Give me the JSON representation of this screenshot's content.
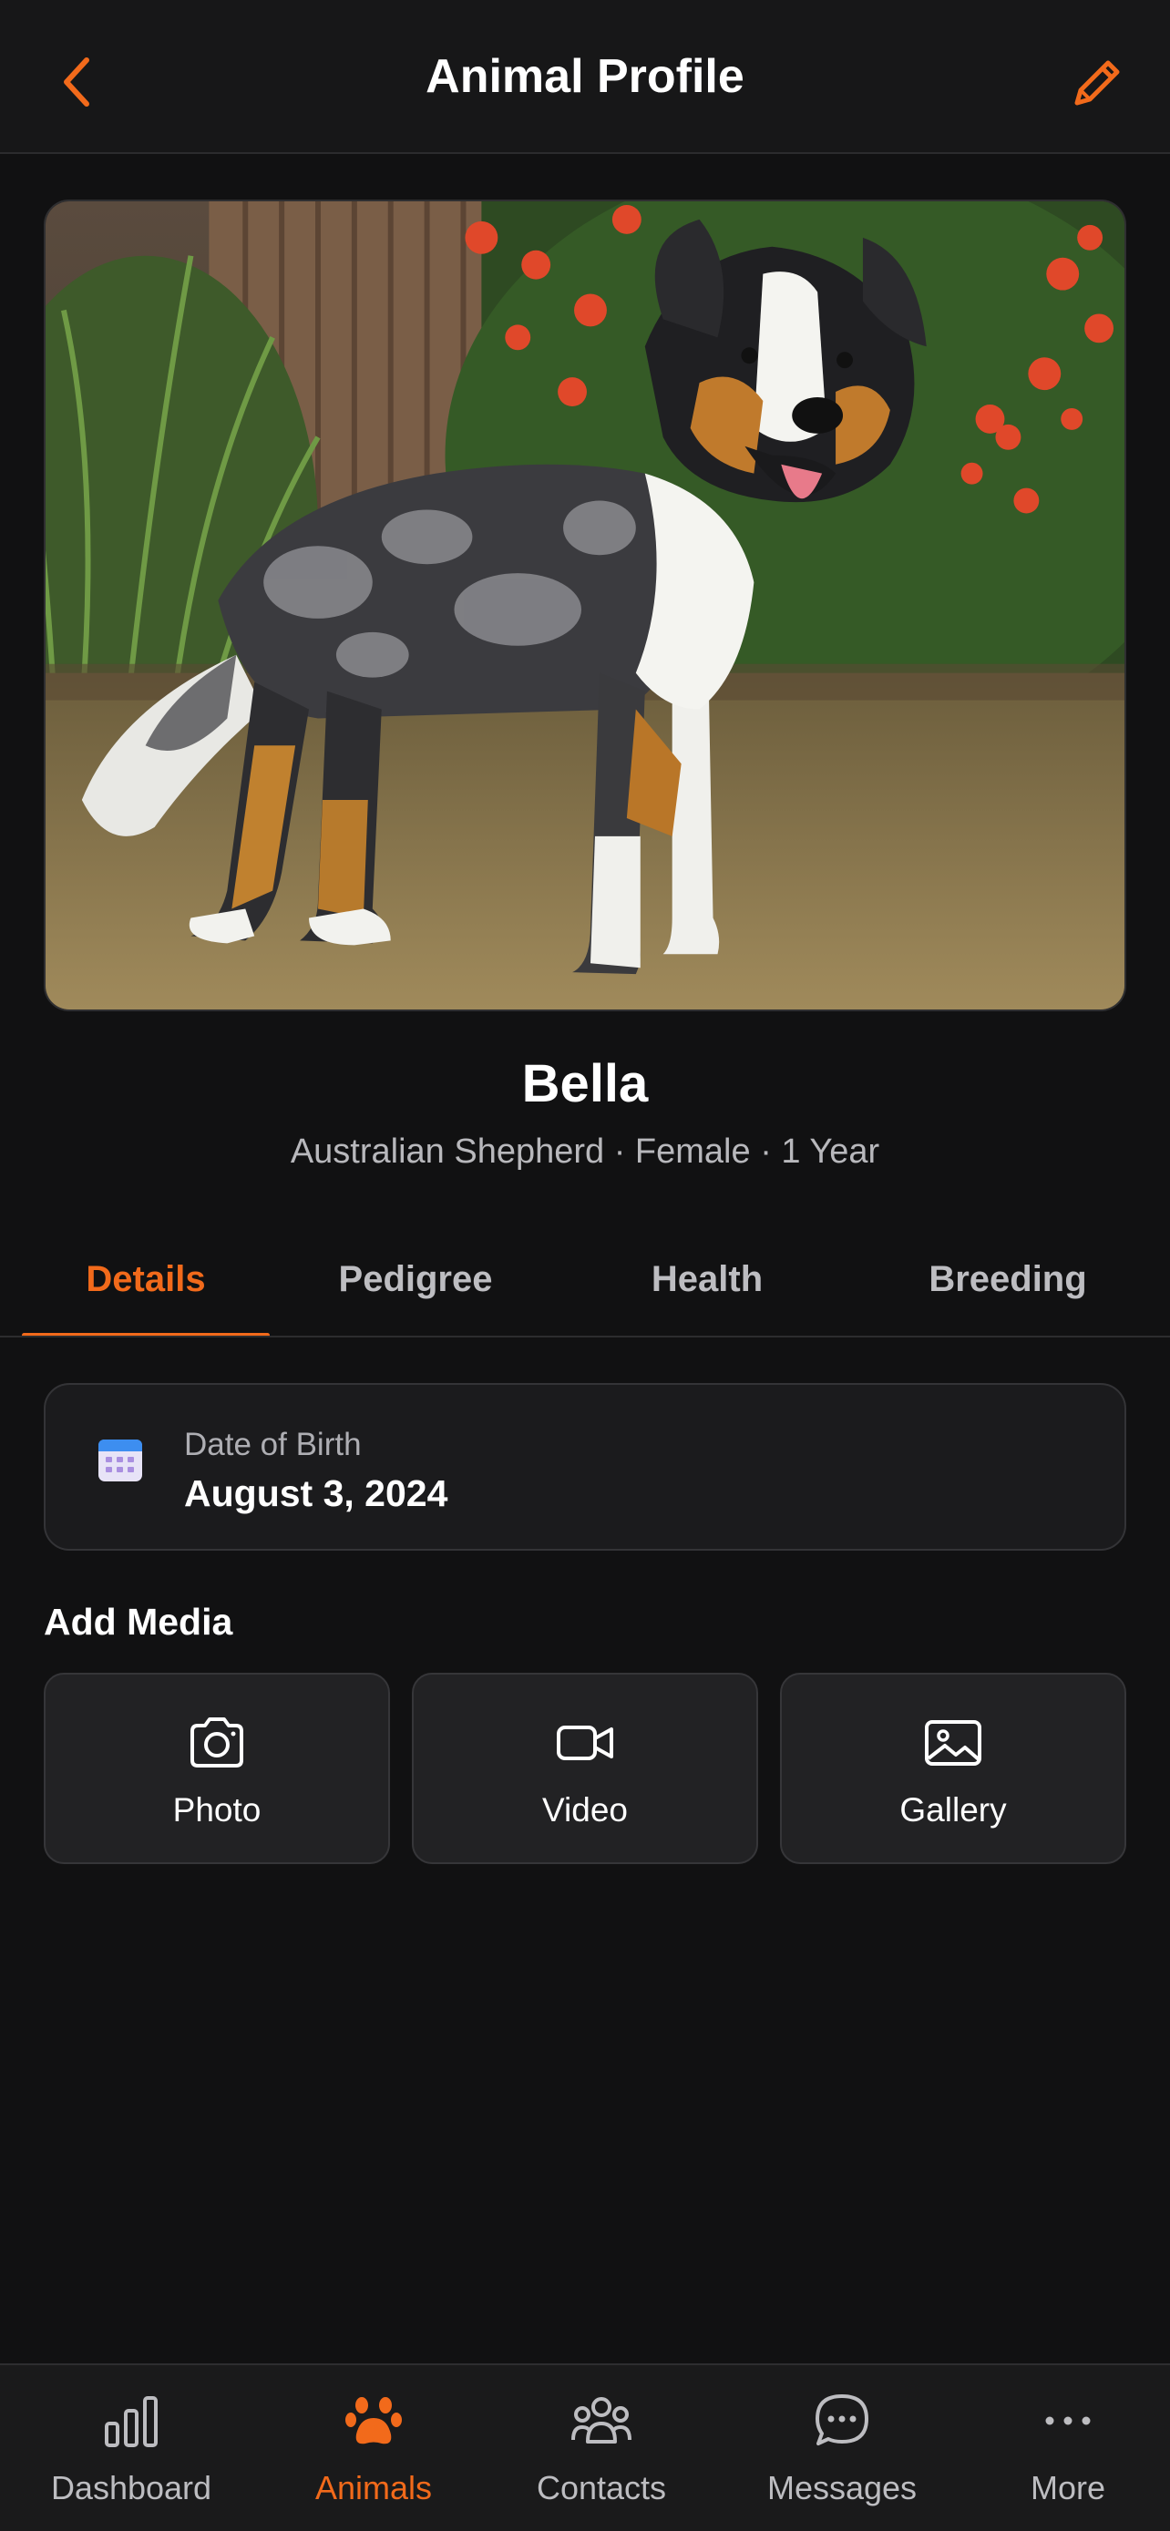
{
  "header": {
    "title": "Animal Profile",
    "back_icon": "chevron-left-icon",
    "edit_icon": "pencil-icon",
    "accent": "#f26a1b"
  },
  "animal": {
    "name": "Bella",
    "subtitle": "Australian Shepherd · Female · 1 Year"
  },
  "tabs": [
    {
      "label": "Details",
      "active": true
    },
    {
      "label": "Pedigree",
      "active": false
    },
    {
      "label": "Health",
      "active": false
    },
    {
      "label": "Breeding",
      "active": false
    }
  ],
  "details": {
    "dob_label": "Date of Birth",
    "dob_value": "August 3, 2024",
    "dob_icon": "calendar-icon"
  },
  "media": {
    "title": "Add Media",
    "buttons": [
      {
        "label": "Photo",
        "icon": "camera-icon"
      },
      {
        "label": "Video",
        "icon": "video-camera-icon"
      },
      {
        "label": "Gallery",
        "icon": "image-icon"
      }
    ]
  },
  "nav": [
    {
      "label": "Dashboard",
      "icon": "bar-chart-icon",
      "active": false
    },
    {
      "label": "Animals",
      "icon": "paw-icon",
      "active": true
    },
    {
      "label": "Contacts",
      "icon": "people-icon",
      "active": false
    },
    {
      "label": "Messages",
      "icon": "chat-bubble-icon",
      "active": false
    },
    {
      "label": "More",
      "icon": "more-dots-icon",
      "active": false
    }
  ]
}
